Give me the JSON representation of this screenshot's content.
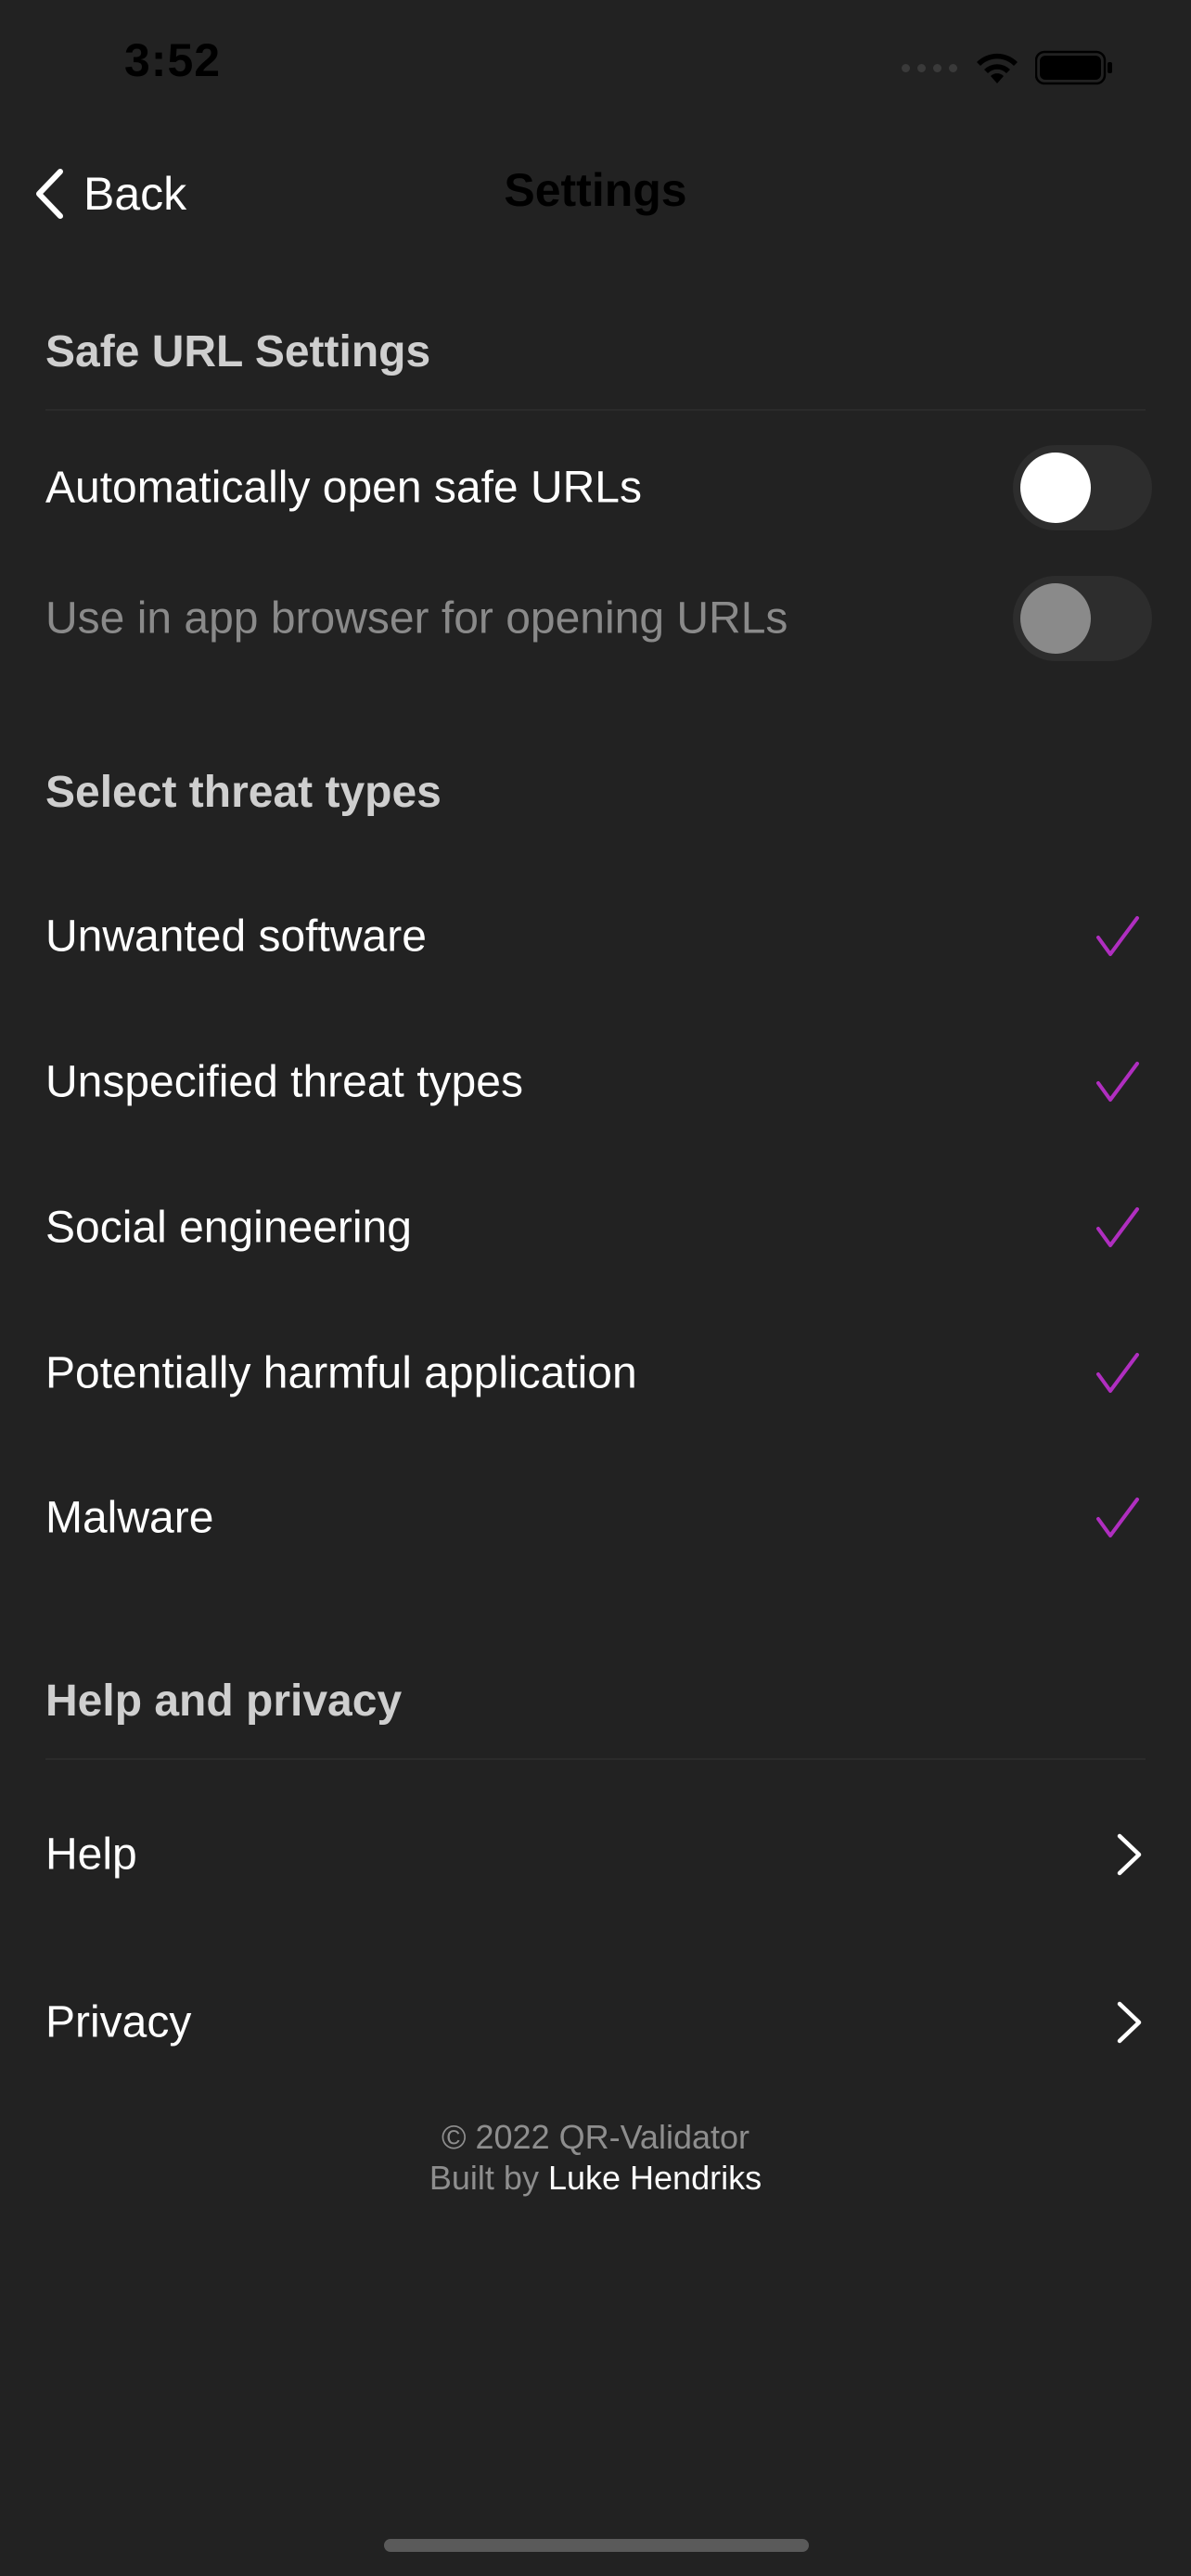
{
  "status_bar": {
    "time": "3:52"
  },
  "nav": {
    "back_label": "Back",
    "title": "Settings"
  },
  "sections": {
    "safe_url": {
      "header": "Safe URL Settings",
      "rows": [
        {
          "label": "Automatically open safe URLs",
          "toggle": "off",
          "enabled": true
        },
        {
          "label": "Use in app browser for opening URLs",
          "toggle": "off",
          "enabled": false
        }
      ]
    },
    "threats": {
      "header": "Select threat types",
      "rows": [
        {
          "label": "Unwanted software",
          "checked": true
        },
        {
          "label": "Unspecified threat types",
          "checked": true
        },
        {
          "label": "Social engineering",
          "checked": true
        },
        {
          "label": "Potentially harmful application",
          "checked": true
        },
        {
          "label": "Malware",
          "checked": true
        }
      ]
    },
    "help": {
      "header": "Help and privacy",
      "rows": [
        {
          "label": "Help"
        },
        {
          "label": "Privacy"
        }
      ]
    }
  },
  "footer": {
    "copyright": "© 2022 QR-Validator",
    "built_by": "Built by",
    "author": "Luke Hendriks"
  },
  "colors": {
    "background": "#222222",
    "accent_check": "#b02ec0",
    "toggle_track": "#2d2d2d"
  },
  "icons": {
    "back": "chevron-left-icon",
    "check": "checkmark-icon",
    "disclosure": "chevron-right-icon",
    "wifi": "wifi-icon",
    "battery": "battery-icon"
  }
}
